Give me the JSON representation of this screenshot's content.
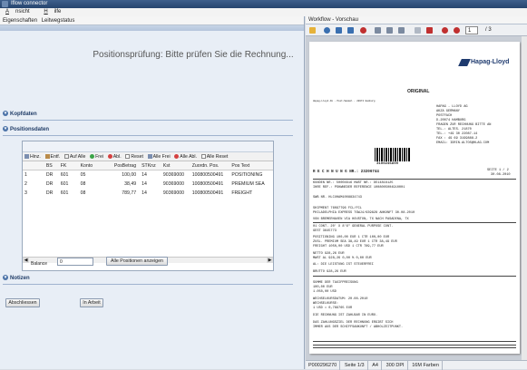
{
  "app": {
    "title": "Iflow connector"
  },
  "menu": {
    "items": [
      {
        "prefix": "A",
        "rest": "nsicht"
      },
      {
        "prefix": "H",
        "rest": "ilfe"
      }
    ]
  },
  "left": {
    "tabs": [
      "Eigenschaften",
      "Leitwegstatus"
    ],
    "status_title": "Positionsprüfung: Bitte prüfen Sie die Rechnung...",
    "sections": {
      "kopfdaten": "Kopfdaten",
      "positionsdaten": "Positionsdaten",
      "notizen": "Notizen"
    },
    "toolbar": [
      "Hinz.",
      "Entf.",
      "Auf Alle",
      "Frei",
      "Abl.",
      "Reset",
      "Alle Frei",
      "Alle Abl.",
      "Alle Reset"
    ],
    "grid": {
      "columns": [
        "",
        "BS",
        "FK",
        "Konto",
        "PosBetrag",
        "STKnz",
        "Kst",
        "Zuordn. Pos.",
        "Pos Text"
      ],
      "rows": [
        [
          "1",
          "DR",
          "601",
          "05",
          "100,00",
          "14",
          "90369000",
          "100800500491",
          "POSITIONING"
        ],
        [
          "2",
          "DR",
          "601",
          "08",
          "38,49",
          "14",
          "90369000",
          "100800500491",
          "PREMIUM SEA"
        ],
        [
          "3",
          "DR",
          "601",
          "08",
          "789,77",
          "14",
          "90369000",
          "100800500491",
          "FREIGHT"
        ]
      ]
    },
    "balance": {
      "label": "Balance",
      "value": "0"
    },
    "show_all_button": "Alle Positionen anzeigen",
    "buttons": {
      "close": "Abschliessen",
      "in_work": "In Arbeit"
    }
  },
  "right": {
    "title": "Workflow - Vorschau",
    "page_current": "1",
    "page_total": "/ 3",
    "document": {
      "brand": "Hapag-Lloyd",
      "original": "ORIGINAL",
      "barcode_number": "3100245899",
      "address": [
        "HAPAG - LLOYD AG",
        "AKZA GERMANY",
        "POSTFACH",
        "D-20074 HAMBURG",
        "FRAGEN ZUR RECHNUNG BITTE AN",
        "TEL.: ALTES. 21870",
        "TEL.: +49 30 22087-14",
        "FAX : 49 69 3199888-2",
        "EMAIL: IDRIN.ALTOS@HLAG.COM"
      ],
      "invoice_line": "R E C H N U N G   NR.:        23206744",
      "page_ref": "SEITE  1 / 2",
      "date": "30.08.2010",
      "lines": [
        "KUNDEN NR.: 50004616  HWST NR.:  DE14816125",
        "IHRE REF.:  PSHWNEDER REFERENCE  1008005004910001",
        "SWB NR.    HLCUHAM1008834743",
        "SHIPMENT    76097796  FCL/FCL",
        "PHILADELPHIA EXPRESS         TGWJ4/639828       ANKUNFT 30.08.2010",
        "VON  BREMERHAVEN        VIA  HOUSTON, TX      NACH PASADENA, TX",
        "01 CONT. 20' X 8'6\" GENERAL PURPOSE CONT.",
        "GEST  3645773",
        "POSITIONING                    100,00 EUR    1 CTR       100,00 EUR",
        "ZUSL. PREMIUM SEA              38,49 EUR    1 CTR        38,49 EUR",
        "FREIGHT                       1050,00 USD    1 CTR       789,77 EUR",
        "NETTO                                                    928,26 EUR",
        "MWST      AL          928,26     0,00 %                    0,00 EUR",
        "   AL: DIE LEISTUNG IST STEUERFREI",
        "BRUTTO                                                   928,26 EUR",
        "SUMME DER TAXIFPREISUNG",
        "        100,00 EUR",
        "      1.050,00 USD",
        "WECHSELKURSDATUM:   20.08.2010",
        "WECHSELKURSE:",
        "             1 USD =     0,789765 EUR",
        "DIE RECHNUNG IST ZAHLBAR IN EURO.",
        "DAS ZAHLUNGSZIEL DER RECHNUNG ERGIBT SICH",
        "IMMER AUS DER SCHIFFSANKUNFT / ABHOLZEITPUNKT."
      ]
    },
    "status": [
      "P000296270",
      "Seite 1/3",
      "A4",
      "300 DPI",
      "16M Farben"
    ]
  }
}
